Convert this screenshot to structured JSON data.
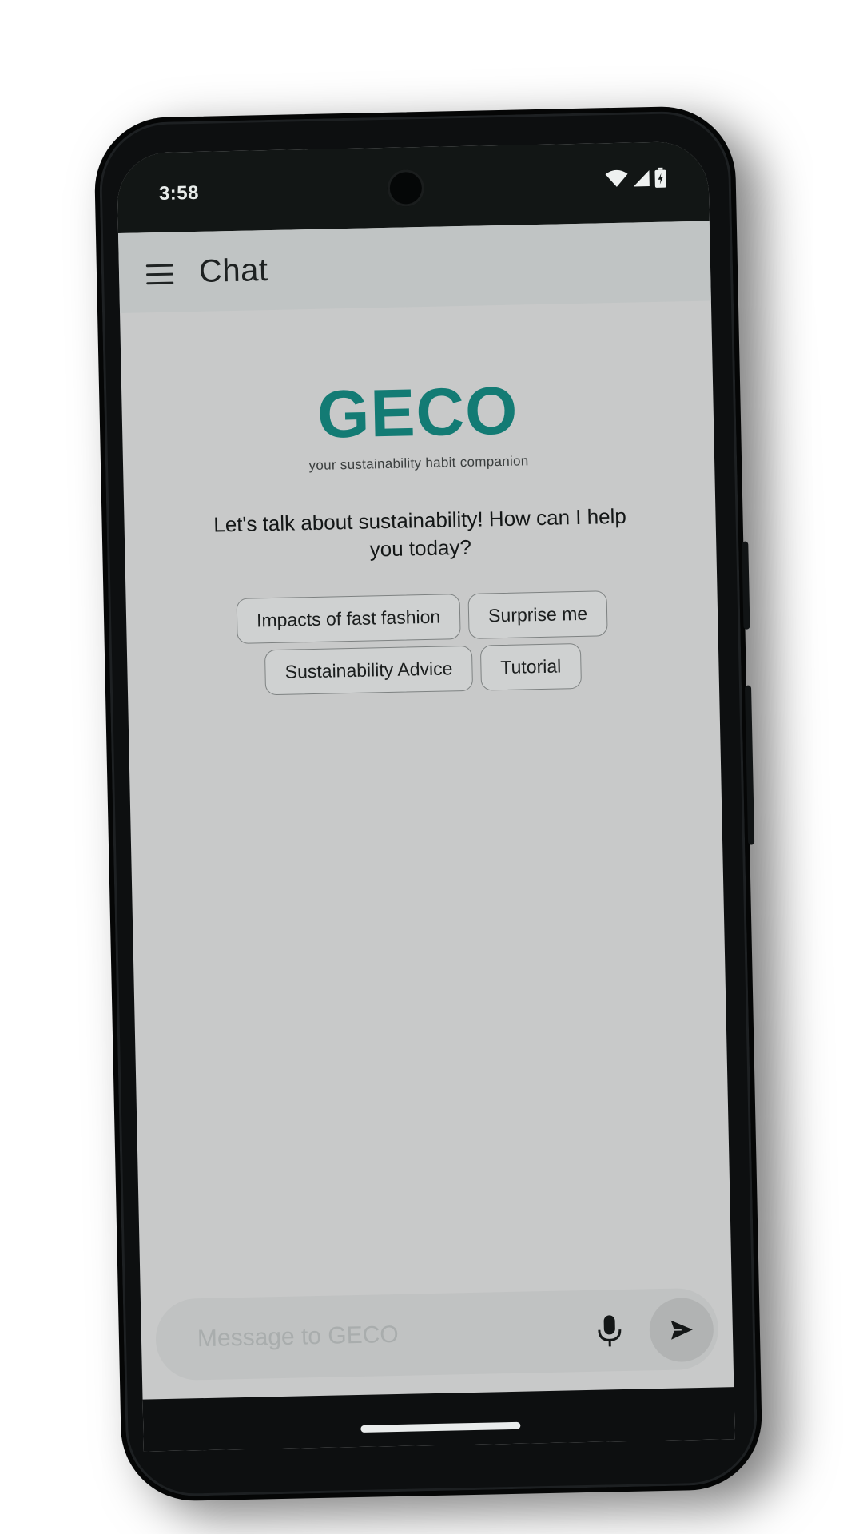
{
  "status_bar": {
    "time": "3:58",
    "icons": [
      "wifi-icon",
      "signal-icon",
      "battery-icon"
    ]
  },
  "app_bar": {
    "menu_icon": "hamburger-menu-icon",
    "title": "Chat"
  },
  "hero": {
    "logo_text": "GECO",
    "tagline": "your sustainability habit companion",
    "greeting": "Let's talk about sustainability! How can I help you today?"
  },
  "suggestions": [
    {
      "label": "Impacts of fast fashion"
    },
    {
      "label": "Surprise me"
    },
    {
      "label": "Sustainability Advice"
    },
    {
      "label": "Tutorial"
    }
  ],
  "composer": {
    "placeholder": "Message to GECO",
    "value": "",
    "mic_icon": "microphone-icon",
    "send_icon": "send-icon"
  },
  "colors": {
    "brand_teal": "#137b74",
    "screen_bg": "#c8c9c9",
    "app_bar_bg": "#c0c4c4",
    "status_bar_bg": "#121615"
  }
}
